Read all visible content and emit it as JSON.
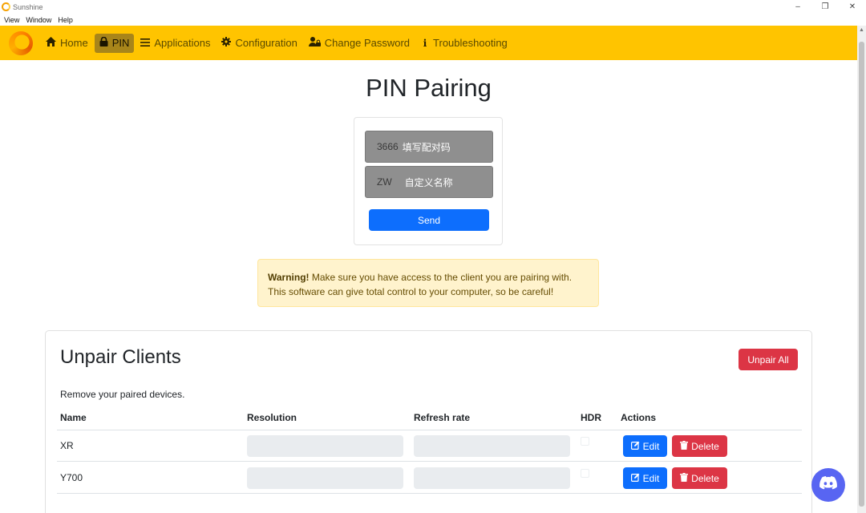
{
  "window": {
    "title": "Sunshine",
    "controls": {
      "minimize": "–",
      "restore": "❐",
      "close": "✕"
    }
  },
  "menubar": [
    "View",
    "Window",
    "Help"
  ],
  "nav": {
    "items": [
      {
        "label": "Home",
        "icon": "home-icon",
        "glyph": "⌂"
      },
      {
        "label": "PIN",
        "icon": "lock-icon",
        "glyph": "🔒",
        "active": true
      },
      {
        "label": "Applications",
        "icon": "list-icon",
        "glyph": "☰"
      },
      {
        "label": "Configuration",
        "icon": "gear-icon",
        "glyph": "⚙"
      },
      {
        "label": "Change Password",
        "icon": "user-lock-icon",
        "glyph": "👤"
      },
      {
        "label": "Troubleshooting",
        "icon": "info-icon",
        "glyph": "i"
      }
    ],
    "accent": "#ffc400"
  },
  "pin": {
    "title": "PIN Pairing",
    "pin_value": "3666",
    "pin_overlay": "填写配对码",
    "name_value": "ZW",
    "name_overlay": "自定义名称",
    "send_label": "Send"
  },
  "warning": {
    "strong": "Warning!",
    "line1": " Make sure you have access to the client you are pairing with.",
    "line2": "This software can give total control to your computer, so be careful!"
  },
  "clients": {
    "title": "Unpair Clients",
    "unpair_all_label": "Unpair All",
    "description": "Remove your paired devices.",
    "columns": [
      "Name",
      "Resolution",
      "Refresh rate",
      "HDR",
      "Actions"
    ],
    "rows": [
      {
        "name": "XR",
        "edit": "Edit",
        "delete": "Delete"
      },
      {
        "name": "Y700",
        "edit": "Edit",
        "delete": "Delete"
      }
    ]
  },
  "colors": {
    "primary": "#0d6efd",
    "danger": "#dc3545",
    "warning_bg": "#fff3cd",
    "discord": "#5865f2"
  }
}
